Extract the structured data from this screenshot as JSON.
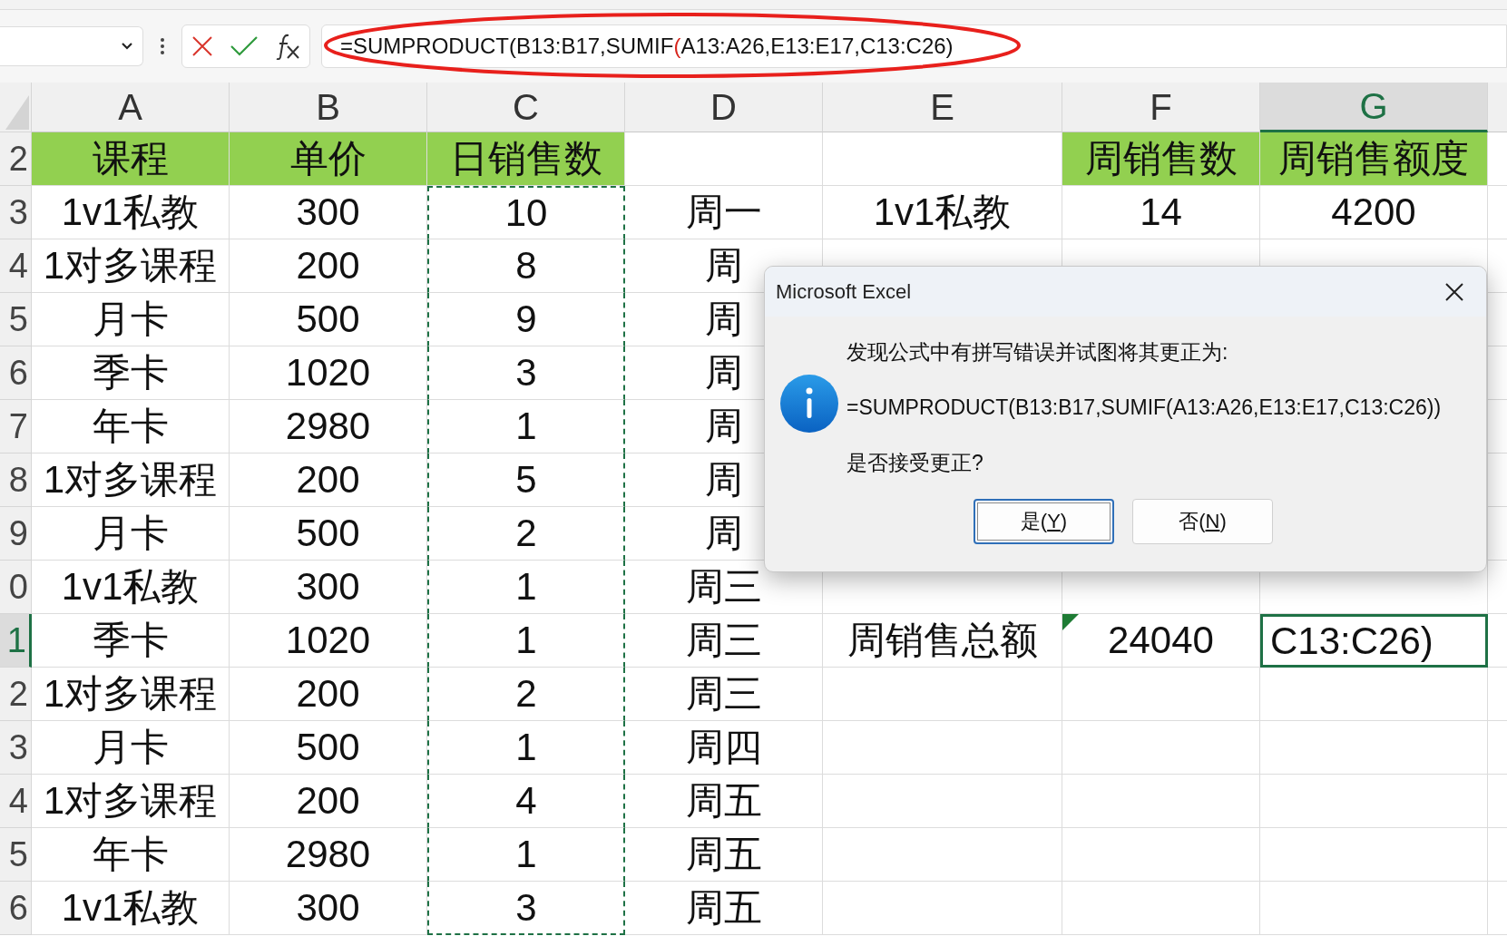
{
  "formula_bar": {
    "segments": [
      {
        "text": "=SUMPRODUCT(B13:B17,SUMIF",
        "highlight": false
      },
      {
        "text": "(",
        "highlight": true
      },
      {
        "text": "A13:A26,E13:E17,C13:C26)",
        "highlight": false
      }
    ],
    "annotated": true
  },
  "columns": [
    {
      "label": "A",
      "selected": false,
      "copied": false
    },
    {
      "label": "B",
      "selected": false,
      "copied": false
    },
    {
      "label": "C",
      "selected": false,
      "copied": true
    },
    {
      "label": "D",
      "selected": false,
      "copied": false
    },
    {
      "label": "E",
      "selected": false,
      "copied": false
    },
    {
      "label": "F",
      "selected": false,
      "copied": false
    },
    {
      "label": "G",
      "selected": true,
      "copied": false
    }
  ],
  "rows": [
    {
      "num": "2",
      "selected": false,
      "kind": "header",
      "cells": [
        "课程",
        "单价",
        "日销售数",
        null,
        null,
        "周销售数",
        "周销售额度"
      ]
    },
    {
      "num": "3",
      "selected": false,
      "kind": "data",
      "cells": [
        "1v1私教",
        "300",
        "10",
        "周一",
        "1v1私教",
        "14",
        "4200"
      ]
    },
    {
      "num": "4",
      "selected": false,
      "kind": "data",
      "cells": [
        "1对多课程",
        "200",
        "8",
        "周",
        null,
        null,
        null
      ]
    },
    {
      "num": "5",
      "selected": false,
      "kind": "data",
      "cells": [
        "月卡",
        "500",
        "9",
        "周",
        null,
        null,
        null
      ]
    },
    {
      "num": "6",
      "selected": false,
      "kind": "data",
      "cells": [
        "季卡",
        "1020",
        "3",
        "周",
        null,
        null,
        null
      ]
    },
    {
      "num": "7",
      "selected": false,
      "kind": "data",
      "cells": [
        "年卡",
        "2980",
        "1",
        "周",
        null,
        null,
        null
      ]
    },
    {
      "num": "8",
      "selected": false,
      "kind": "data",
      "cells": [
        "1对多课程",
        "200",
        "5",
        "周",
        null,
        null,
        null
      ]
    },
    {
      "num": "9",
      "selected": false,
      "kind": "data",
      "cells": [
        "月卡",
        "500",
        "2",
        "周",
        null,
        null,
        null
      ]
    },
    {
      "num": "0",
      "selected": false,
      "kind": "data",
      "cells": [
        "1v1私教",
        "300",
        "1",
        "周三",
        null,
        null,
        null
      ]
    },
    {
      "num": "1",
      "selected": true,
      "kind": "data",
      "warnings": [
        false,
        false,
        false,
        false,
        false,
        true,
        false
      ],
      "cells": [
        "季卡",
        "1020",
        "1",
        "周三",
        "周销售总额",
        "24040",
        "C13:C26)"
      ]
    },
    {
      "num": "2",
      "selected": false,
      "kind": "data",
      "cells": [
        "1对多课程",
        "200",
        "2",
        "周三",
        null,
        null,
        null
      ]
    },
    {
      "num": "3",
      "selected": false,
      "kind": "data",
      "cells": [
        "月卡",
        "500",
        "1",
        "周四",
        null,
        null,
        null
      ]
    },
    {
      "num": "4",
      "selected": false,
      "kind": "data",
      "cells": [
        "1对多课程",
        "200",
        "4",
        "周五",
        null,
        null,
        null
      ]
    },
    {
      "num": "5",
      "selected": false,
      "kind": "data",
      "cells": [
        "年卡",
        "2980",
        "1",
        "周五",
        null,
        null,
        null
      ]
    },
    {
      "num": "6",
      "selected": false,
      "kind": "data",
      "cells": [
        "1v1私教",
        "300",
        "3",
        "周五",
        null,
        null,
        null
      ]
    }
  ],
  "dialog": {
    "title": "Microsoft Excel",
    "message": "发现公式中有拼写错误并试图将其更正为:",
    "formula": "=SUMPRODUCT(B13:B17,SUMIF(A13:A26,E13:E17,C13:C26))",
    "question": "是否接受更正?",
    "buttons": [
      {
        "prefix": "是(",
        "key": "Y",
        "suffix": ")",
        "selected": true
      },
      {
        "prefix": "否(",
        "key": "N",
        "suffix": ")",
        "selected": false
      }
    ]
  }
}
